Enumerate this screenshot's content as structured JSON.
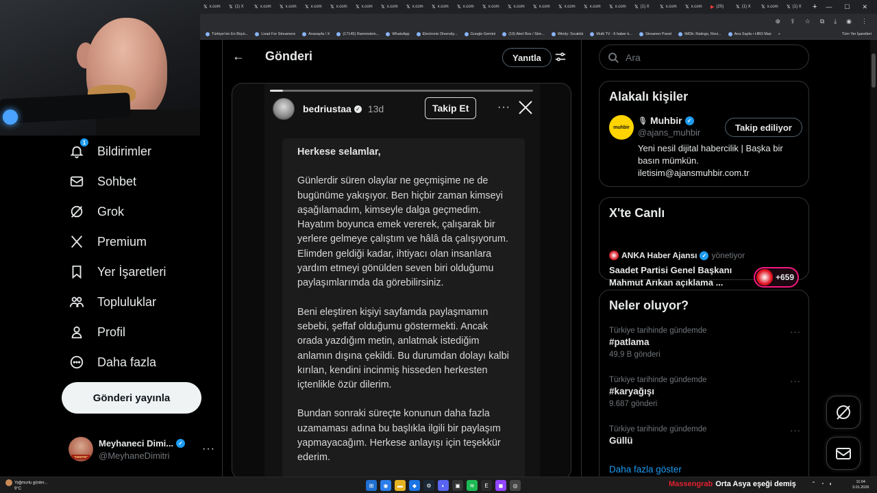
{
  "browser": {
    "tabs": [
      "x.com",
      "(1) X",
      "x.com",
      "x.com",
      "x.com",
      "x.com",
      "x.com",
      "x.com",
      "x.com",
      "x.com",
      "x.com",
      "x.com",
      "x.com",
      "x.com",
      "x.com",
      "x.com",
      "x.com",
      "(1) X",
      "x.com",
      "x.com",
      "(20)",
      "(1) X",
      "x.com",
      "(1) X"
    ],
    "new_tab": "+",
    "bookmarks": [
      "Türkiye'nin En Büyü...",
      "Livad For Streamers",
      "Anasayfa / X",
      "(17145) Rammstein...",
      "WhatsApp",
      "Electronic Diversity...",
      "Google Gemini",
      "(19) Alert Box / Stre...",
      "Windy: Sıcaklık",
      "Multi TV - 6 haber k...",
      "Streamer Panel",
      "IMDb: Ratings, Revi...",
      "Ana Sayfa • HBO Max"
    ],
    "bookmarks_more": "»",
    "all_bookmarks": "Tüm Yer İşaretleri"
  },
  "sidebar": {
    "items": [
      {
        "label": "Bildirimler",
        "icon": "bell-icon",
        "badge": "1"
      },
      {
        "label": "Sohbet",
        "icon": "mail-icon"
      },
      {
        "label": "Grok",
        "icon": "grok-icon"
      },
      {
        "label": "Premium",
        "icon": "x-logo-icon"
      },
      {
        "label": "Yer İşaretleri",
        "icon": "bookmark-icon"
      },
      {
        "label": "Topluluklar",
        "icon": "communities-icon"
      },
      {
        "label": "Profil",
        "icon": "profile-icon"
      },
      {
        "label": "Daha fazla",
        "icon": "more-circle-icon"
      }
    ],
    "post_button": "Gönderi yayınla",
    "account": {
      "name": "Meyhaneci Dimi...",
      "handle": "@MeyhaneDimitri",
      "avatar_tag": "\"DIMITRI\"",
      "more": "···"
    }
  },
  "main": {
    "back": "←",
    "title": "Gönderi",
    "reply_button": "Yanıtla",
    "story": {
      "username": "bedriustaa",
      "time": "13d",
      "follow_button": "Takip Et",
      "more": "···",
      "progress": 0.05,
      "greeting": "Herkese selamlar,",
      "paragraphs": [
        "Günlerdir süren olaylar ne geçmişime ne de bugünüme yakışıyor. Ben hiçbir zaman kimseyi aşağılamadım, kimseyle dalga geçmedim. Hayatım boyunca emek vererek, çalışarak bir yerlere gelmeye çalıştım ve hâlâ da çalışıyorum. Elimden geldiği kadar, ihtiyacı olan insanlara yardım etmeyi gönülden seven biri olduğumu paylaşımlarımda da görebilirsiniz.",
        "Beni eleştiren kişiyi sayfamda paylaşmamın sebebi, şeffaf olduğumu göstermekti. Ancak orada yazdığım metin, anlatmak istediğim anlamın dışına çekildi. Bu durumdan dolayı kalbi kırılan, kendini incinmiş hisseden herkesten içtenlikle özür dilerim.",
        "Bundan sonraki süreçte konunun daha fazla uzamaması adına bu başlıkla ilgili bir paylaşım yapmayacağım. Herkese anlayışı için teşekkür ederim."
      ]
    }
  },
  "right": {
    "search_placeholder": "Ara",
    "related": {
      "title": "Alakalı kişiler",
      "name": "Muhbir",
      "handle": "@ajans_muhbir",
      "avatar_text": "muhbir",
      "follow_button": "Takip ediliyor",
      "bio": "Yeni nesil dijital habercilik | Başka bir basın mümkün. iletisim@ajansmuhbir.com.tr"
    },
    "live": {
      "title": "X'te Canlı",
      "host": "ANKA Haber Ajansı",
      "host_role": "yönetiyor",
      "topic": "Saadet Partisi Genel Başkanı Mahmut Arıkan açıklama ...",
      "listeners": "+659"
    },
    "trends": {
      "title": "Neler oluyor?",
      "items": [
        {
          "context": "Türkiye tarihinde gündemde",
          "topic": "#patlama",
          "count": "49,9 B gönderi"
        },
        {
          "context": "Türkiye tarihinde gündemde",
          "topic": "#karyağışı",
          "count": "9.687 gönderi"
        },
        {
          "context": "Türkiye tarihinde gündemde",
          "topic": "Güllü",
          "count": ""
        }
      ],
      "more": "···",
      "show_more": "Daha fazla göster"
    }
  },
  "taskbar": {
    "weather_line1": "Yağmurlu günler...",
    "weather_line2": "9°C",
    "ticker_source": "Massengrab",
    "ticker_text": "Orta Asya eşeği demiş",
    "time": "11:04",
    "date": "3.01.2026"
  },
  "colors": {
    "accent": "#1d9bf0",
    "live": "#f91880",
    "background": "#000000",
    "muhbir": "#ffd400"
  }
}
